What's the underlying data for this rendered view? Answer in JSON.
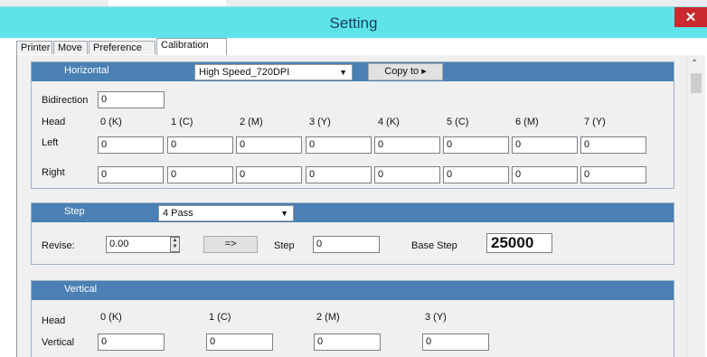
{
  "window": {
    "title": "Setting",
    "close_glyph": "✕"
  },
  "tabs": [
    "Printer",
    "Move",
    "Preference",
    "Calibration"
  ],
  "horizontal": {
    "section_label": "Horizontal",
    "mode_value": "High Speed_720DPI",
    "copy_to_label": "Copy to ▸",
    "bidirection_label": "Bidirection",
    "bidirection_value": "0",
    "head_label": "Head",
    "heads": [
      "0 (K)",
      "1 (C)",
      "2 (M)",
      "3 (Y)",
      "4 (K)",
      "5 (C)",
      "6 (M)",
      "7 (Y)"
    ],
    "left_label": "Left",
    "left_values": [
      "0",
      "0",
      "0",
      "0",
      "0",
      "0",
      "0",
      "0"
    ],
    "right_label": "Right",
    "right_values": [
      "0",
      "0",
      "0",
      "0",
      "0",
      "0",
      "0",
      "0"
    ]
  },
  "step": {
    "section_label": "Step",
    "pass_value": "4 Pass",
    "revise_label": "Revise:",
    "revise_value": "0.00",
    "apply_label": "=>",
    "step_label": "Step",
    "step_value": "0",
    "base_step_label": "Base Step",
    "base_step_value": "25000"
  },
  "vertical": {
    "section_label": "Vertical",
    "head_label": "Head",
    "heads": [
      "0 (K)",
      "1 (C)",
      "2 (M)",
      "3 (Y)"
    ],
    "vertical_label": "Vertical",
    "values": [
      "0",
      "0",
      "0",
      "0"
    ]
  },
  "icons": {
    "dropdown": "chevron-down-icon",
    "scroll_up": "scroll-up-icon",
    "close": "close-icon"
  }
}
